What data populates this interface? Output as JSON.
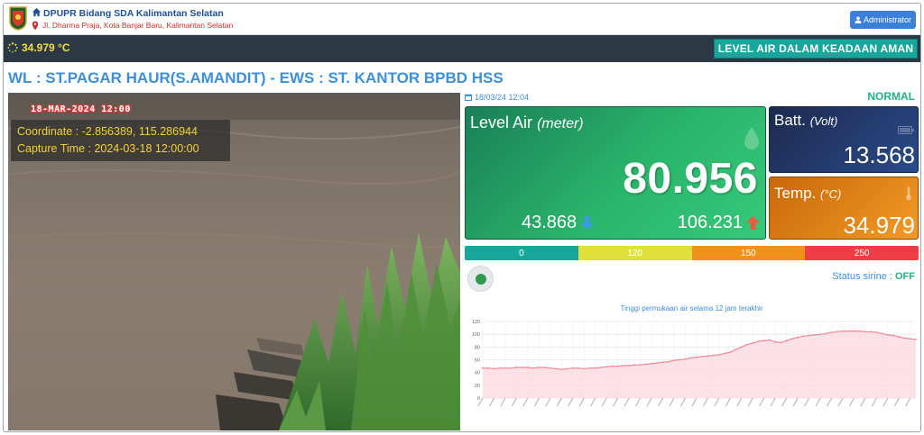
{
  "header": {
    "org_name": "DPUPR Bidang SDA Kalimantan Selatan",
    "address": "Jl. Dharma Praja, Kota Banjar Baru, Kalimantan Selatan",
    "admin_label": "Administrator"
  },
  "status_bar": {
    "temperature": "34.979 °C",
    "alert_banner": "LEVEL AIR DALAM KEADAAN AMAN"
  },
  "station": {
    "title": "WL : ST.PAGAR HAUR(S.AMANDIT) - EWS : ST. KANTOR BPBD HSS"
  },
  "camera": {
    "overlay_date": "18-MAR-2024 12:00",
    "coordinate": "Coordinate : -2.856389, 115.286944",
    "capture_time": "Capture Time : 2024-03-18 12:00:00"
  },
  "reading": {
    "timestamp": "18/03/24 12:04",
    "status": "NORMAL",
    "level_label": "Level Air",
    "level_unit": "(meter)",
    "level_value": "80.956",
    "level_min": "43.868",
    "level_max": "106.231",
    "batt_label": "Batt.",
    "batt_unit": "(Volt)",
    "batt_value": "13.568",
    "temp_label": "Temp.",
    "temp_unit": "(°C)",
    "temp_value": "34.979"
  },
  "thresholds": [
    "0",
    "120",
    "150",
    "250"
  ],
  "colors": {
    "safe": "#17a69c",
    "alert1": "#e0e03a",
    "alert2": "#f0921a",
    "danger": "#ee3d45",
    "chart_line": "#f08a98",
    "chart_fill": "#fbdde2"
  },
  "siren": {
    "label": "Status sirine :",
    "value": "OFF"
  },
  "chart_title": "Tinggi permukaan air selama 12 jam terakhir",
  "chart_data": {
    "type": "area",
    "title": "Tinggi permukaan air selama 12 jam terakhir",
    "xlabel": "",
    "ylabel": "",
    "ylim": [
      0,
      120
    ],
    "yticks": [
      0,
      20,
      40,
      60,
      80,
      100,
      120
    ],
    "grid": true,
    "series": [
      {
        "values": [
          47,
          47,
          46,
          47,
          47,
          47,
          48,
          48,
          48,
          47,
          48,
          48,
          47,
          46,
          45,
          46,
          47,
          47,
          46,
          47,
          47,
          48,
          49,
          50,
          50,
          51,
          51,
          52,
          52,
          53,
          54,
          55,
          56,
          57,
          59,
          60,
          61,
          63,
          64,
          65,
          66,
          67,
          68,
          70,
          72,
          76,
          80,
          84,
          86,
          89,
          90,
          91,
          88,
          87,
          90,
          93,
          95,
          97,
          98,
          99,
          100,
          101,
          103,
          104,
          105,
          105,
          105,
          105,
          104,
          104,
          103,
          101,
          99,
          98,
          96,
          94,
          93,
          92
        ]
      }
    ]
  }
}
